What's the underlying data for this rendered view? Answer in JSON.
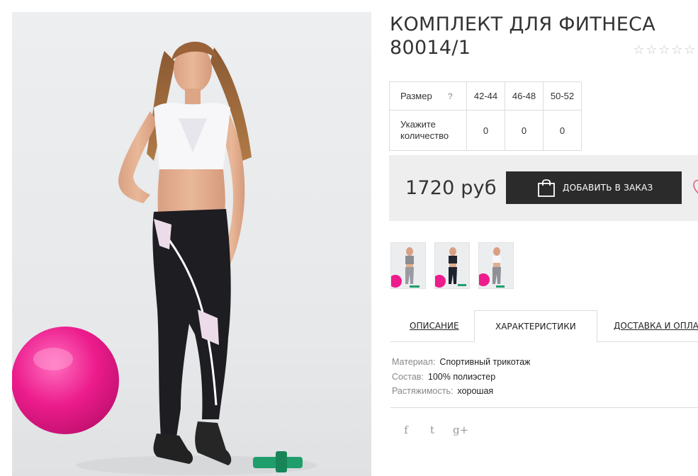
{
  "product": {
    "title_line1": "КОМПЛЕКТ ДЛЯ ФИТНЕСА",
    "title_line2": "80014/1",
    "rating": {
      "value": 0,
      "max": 5
    }
  },
  "sizes": {
    "size_label": "Размер",
    "help_glyph": "?",
    "columns": [
      "42-44",
      "46-48",
      "50-52"
    ],
    "qty_label_line1": "Укажите",
    "qty_label_line2": "количество",
    "quantities": [
      "0",
      "0",
      "0"
    ]
  },
  "purchase": {
    "price": "1720 руб",
    "add_button_label": "ДОБАВИТЬ В ЗАКАЗ"
  },
  "thumbnails": [
    "thumb-grey-outfit",
    "thumb-black-outfit",
    "thumb-white-top-outfit"
  ],
  "tabs": [
    {
      "label": "ОПИСАНИЕ",
      "active": false
    },
    {
      "label": "ХАРАКТЕРИСТИКИ",
      "active": true
    },
    {
      "label": "ДОСТАВКА И ОПЛАТА",
      "active": false
    }
  ],
  "specs": [
    {
      "key": "Материал:",
      "value": "Спортивный трикотаж"
    },
    {
      "key": "Состав:",
      "value": "100% полиэстер"
    },
    {
      "key": "Растяжимость:",
      "value": "хорошая"
    }
  ],
  "social": {
    "facebook": "f",
    "twitter": "t",
    "google_plus": "g+"
  },
  "icons": [
    "shopping-bag-icon",
    "heart-icon",
    "star-icon",
    "facebook-icon",
    "twitter-icon",
    "google-plus-icon"
  ],
  "colors": {
    "button_bg": "#2b2b2b",
    "price_box_bg": "#eeeeee",
    "heart": "#e0607e",
    "ball": "#ef1f8f",
    "dumbbell": "#1f9e6c"
  }
}
